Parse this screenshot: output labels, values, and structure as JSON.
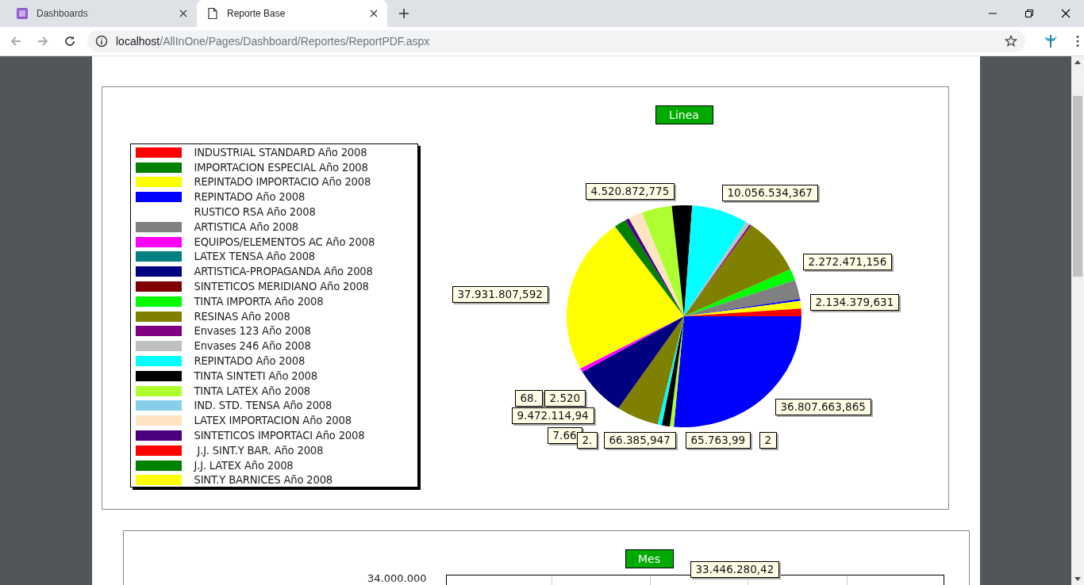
{
  "browser": {
    "tabs": [
      {
        "title": "Dashboards",
        "selected": false
      },
      {
        "title": "Reporte Base",
        "selected": true
      }
    ],
    "address": {
      "host": "localhost",
      "path": "/AllInOne/Pages/Dashboard/Reportes/ReportPDF.aspx"
    }
  },
  "pie_report": {
    "title": "Linea",
    "legend": [
      {
        "label": "INDUSTRIAL STANDARD Año 2008",
        "color": "#ff0000"
      },
      {
        "label": "IMPORTACION ESPECIAL Año 2008",
        "color": "#008000"
      },
      {
        "label": "REPINTADO IMPORTACIO Año 2008",
        "color": "#ffff00"
      },
      {
        "label": "REPINTADO Año 2008",
        "color": "#0000ff"
      },
      {
        "label": "RUSTICO RSA Año 2008"
      },
      {
        "label": "ARTISTICA Año 2008",
        "color": "#808080"
      },
      {
        "label": "EQUIPOS/ELEMENTOS AC Año 2008",
        "color": "#ff00ff"
      },
      {
        "label": "LATEX TENSA Año 2008",
        "color": "#008080"
      },
      {
        "label": "ARTISTICA-PROPAGANDA Año 2008",
        "color": "#000080"
      },
      {
        "label": "SINTETICOS MERIDIANO Año 2008",
        "color": "#800000"
      },
      {
        "label": "TINTA IMPORTA Año 2008",
        "color": "#00ff00"
      },
      {
        "label": "RESINAS Año 2008",
        "color": "#808000"
      },
      {
        "label": "Envases 123 Año 2008",
        "color": "#800080"
      },
      {
        "label": "Envases 246 Año 2008",
        "color": "#c0c0c0"
      },
      {
        "label": "REPINTADO Año 2008",
        "color": "#00ffff"
      },
      {
        "label": "TINTA SINTETI Año 2008",
        "color": "#000000"
      },
      {
        "label": "TINTA LATEX Año 2008",
        "color": "#adff2f"
      },
      {
        "label": "IND. STD. TENSA Año 2008",
        "color": "#87ceeb"
      },
      {
        "label": "LATEX IMPORTACION Año 2008",
        "color": "#ffe4c4"
      },
      {
        "label": "SINTETICOS IMPORTACI Año 2008",
        "color": "#4b0082"
      },
      {
        "label": " J.J. SINT.Y BAR. Año 2008",
        "color": "#ff0000"
      },
      {
        "label": "J.J. LATEX Año 2008",
        "color": "#008000"
      },
      {
        "label": "SINT.Y BARNICES Año 2008",
        "color": "#ffff00"
      }
    ],
    "value_labels": [
      "4.520.872,775",
      "10.056.534,367",
      "2.272.471,156",
      "2.134.379,631",
      "37.931.807,592",
      "36.807.663,865",
      "68.",
      "2.520",
      "9.472.114,94",
      "7.66",
      "2.",
      "66.385,947",
      "65.763,99",
      "2"
    ]
  },
  "bar_report": {
    "title": "Mes",
    "axis_tick": "34.000.000",
    "value_labels": [
      "33.446.280,42"
    ]
  }
}
